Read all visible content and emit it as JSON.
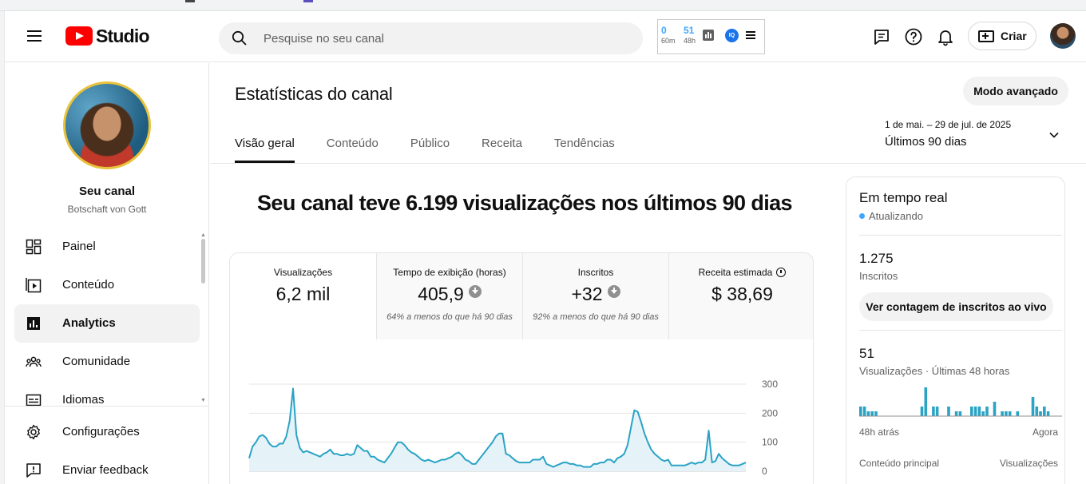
{
  "header": {
    "logo_text": "Studio",
    "search_placeholder": "Pesquise no seu canal",
    "extension": {
      "stat1_value": "0",
      "stat1_unit": "60m",
      "stat2_value": "51",
      "stat2_unit": "48h",
      "badge": "IQ"
    },
    "create_label": "Criar",
    "icons": [
      "menu-icon",
      "feedback-icon",
      "help-icon",
      "bell-icon",
      "create-icon",
      "avatar"
    ]
  },
  "sidebar": {
    "channel_title": "Seu canal",
    "channel_name": "Botschaft von Gott",
    "items": [
      {
        "label": "Painel",
        "icon": "dashboard-icon",
        "active": false
      },
      {
        "label": "Conteúdo",
        "icon": "content-icon",
        "active": false
      },
      {
        "label": "Analytics",
        "icon": "analytics-icon",
        "active": true
      },
      {
        "label": "Comunidade",
        "icon": "community-icon",
        "active": false
      },
      {
        "label": "Idiomas",
        "icon": "subtitles-icon",
        "active": false
      }
    ],
    "bottom_items": [
      {
        "label": "Configurações",
        "icon": "gear-icon"
      },
      {
        "label": "Enviar feedback",
        "icon": "feedback-icon"
      }
    ]
  },
  "main": {
    "page_title": "Estatísticas do canal",
    "advanced_button": "Modo avançado",
    "tabs": [
      {
        "label": "Visão geral",
        "active": true
      },
      {
        "label": "Conteúdo",
        "active": false
      },
      {
        "label": "Público",
        "active": false
      },
      {
        "label": "Receita",
        "active": false
      },
      {
        "label": "Tendências",
        "active": false
      }
    ],
    "date_range": "1 de mai. – 29 de jul. de 2025",
    "date_period": "Últimos 90 dias",
    "headline": "Seu canal teve 6.199 visualizações nos últimos 90 dias",
    "metrics": [
      {
        "label": "Visualizações",
        "value": "6,2 mil",
        "note": ""
      },
      {
        "label": "Tempo de exibição (horas)",
        "value": "405,9",
        "note": "64% a menos do que há 90 dias"
      },
      {
        "label": "Inscritos",
        "value": "+32",
        "note": "92% a menos do que há 90 dias"
      },
      {
        "label": "Receita estimada",
        "value": "$ 38,69",
        "note": ""
      }
    ]
  },
  "realtime": {
    "title": "Em tempo real",
    "status": "Atualizando",
    "subscribers_value": "1.275",
    "subscribers_label": "Inscritos",
    "live_button": "Ver contagem de inscritos ao vivo",
    "views_value": "51",
    "views_label": "Visualizações · Últimas 48 horas",
    "axis_start": "48h atrás",
    "axis_end": "Agora",
    "table_left": "Conteúdo principal",
    "table_right": "Visualizações",
    "bars": [
      2,
      2,
      1,
      1,
      1,
      0,
      0,
      0,
      0,
      0,
      0,
      0,
      0,
      0,
      0,
      0,
      2,
      6,
      0,
      2,
      2,
      0,
      0,
      2,
      0,
      1,
      1,
      0,
      0,
      2,
      2,
      2,
      1,
      2,
      0,
      3,
      0,
      1,
      1,
      1,
      0,
      1,
      0,
      0,
      0,
      4,
      2,
      1,
      2,
      1,
      0,
      0,
      0
    ]
  },
  "colors": {
    "accent": "#3ea6ff",
    "line": "#2aa3c5",
    "brand_red": "#ff0000"
  },
  "chart_data": {
    "type": "area",
    "title": "",
    "xlabel": "",
    "ylabel": "",
    "ylim": [
      0,
      300
    ],
    "yticks": [
      "300",
      "200",
      "100",
      "0"
    ],
    "series": [
      {
        "values": [
          45,
          85,
          100,
          120,
          125,
          115,
          95,
          85,
          85,
          95,
          95,
          120,
          175,
          285,
          125,
          80,
          65,
          70,
          65,
          60,
          55,
          50,
          60,
          65,
          75,
          60,
          60,
          55,
          55,
          60,
          55,
          60,
          90,
          80,
          70,
          70,
          50,
          50,
          40,
          35,
          30,
          45,
          60,
          80,
          100,
          100,
          90,
          75,
          65,
          60,
          50,
          40,
          35,
          40,
          35,
          30,
          35,
          40,
          40,
          45,
          50,
          60,
          65,
          55,
          40,
          35,
          25,
          25,
          40,
          55,
          70,
          85,
          100,
          120,
          130,
          130,
          60,
          55,
          45,
          35,
          30,
          30,
          30,
          30,
          40,
          40,
          40,
          50,
          25,
          20,
          15,
          20,
          25,
          30,
          30,
          25,
          25,
          20,
          20,
          15,
          15,
          15,
          25,
          25,
          30,
          30,
          40,
          40,
          30,
          45,
          50,
          60,
          90,
          150,
          210,
          205,
          170,
          130,
          100,
          75,
          60,
          50,
          40,
          35,
          40,
          20,
          20,
          20,
          20,
          20,
          25,
          30,
          25,
          30,
          30,
          40,
          140,
          30,
          35,
          60,
          45,
          35,
          25,
          20,
          20,
          20,
          25,
          30
        ]
      }
    ]
  }
}
